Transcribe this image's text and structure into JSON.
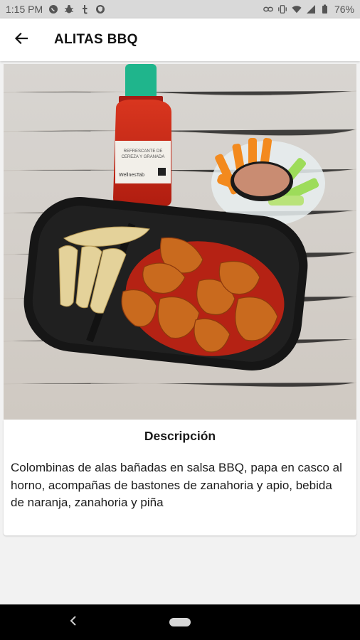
{
  "status_bar": {
    "time": "1:15 PM",
    "battery": "76%",
    "left_icons": [
      "whatsapp-icon",
      "bug-icon",
      "tumblr-icon",
      "shield-icon"
    ],
    "right_icons": [
      "link-icon",
      "vibrate-icon",
      "wifi-icon",
      "signal-icon",
      "battery-icon"
    ]
  },
  "app_bar": {
    "title": "ALITAS BBQ",
    "back_icon": "arrow-left-icon"
  },
  "product": {
    "image_alt": "Alitas BBQ",
    "bottle_label": "REFRESCANTE DE\nCEREZA Y GRANADA\nWellnesTab",
    "description_title": "Descripción",
    "description": "Colombinas de alas bañadas en salsa BBQ, papa en casco al horno, acompañas de bastones de zanahoria y apio, bebida de naranja, zanahoria y piña"
  },
  "nav_bar": {
    "back_icon": "nav-back-icon",
    "home_icon": "home-pill-icon"
  },
  "colors": {
    "app_bar_bg": "#ffffff",
    "status_bar_bg": "#d9d9d9",
    "page_bg": "#f2f2f2",
    "nav_bar_bg": "#000000"
  }
}
